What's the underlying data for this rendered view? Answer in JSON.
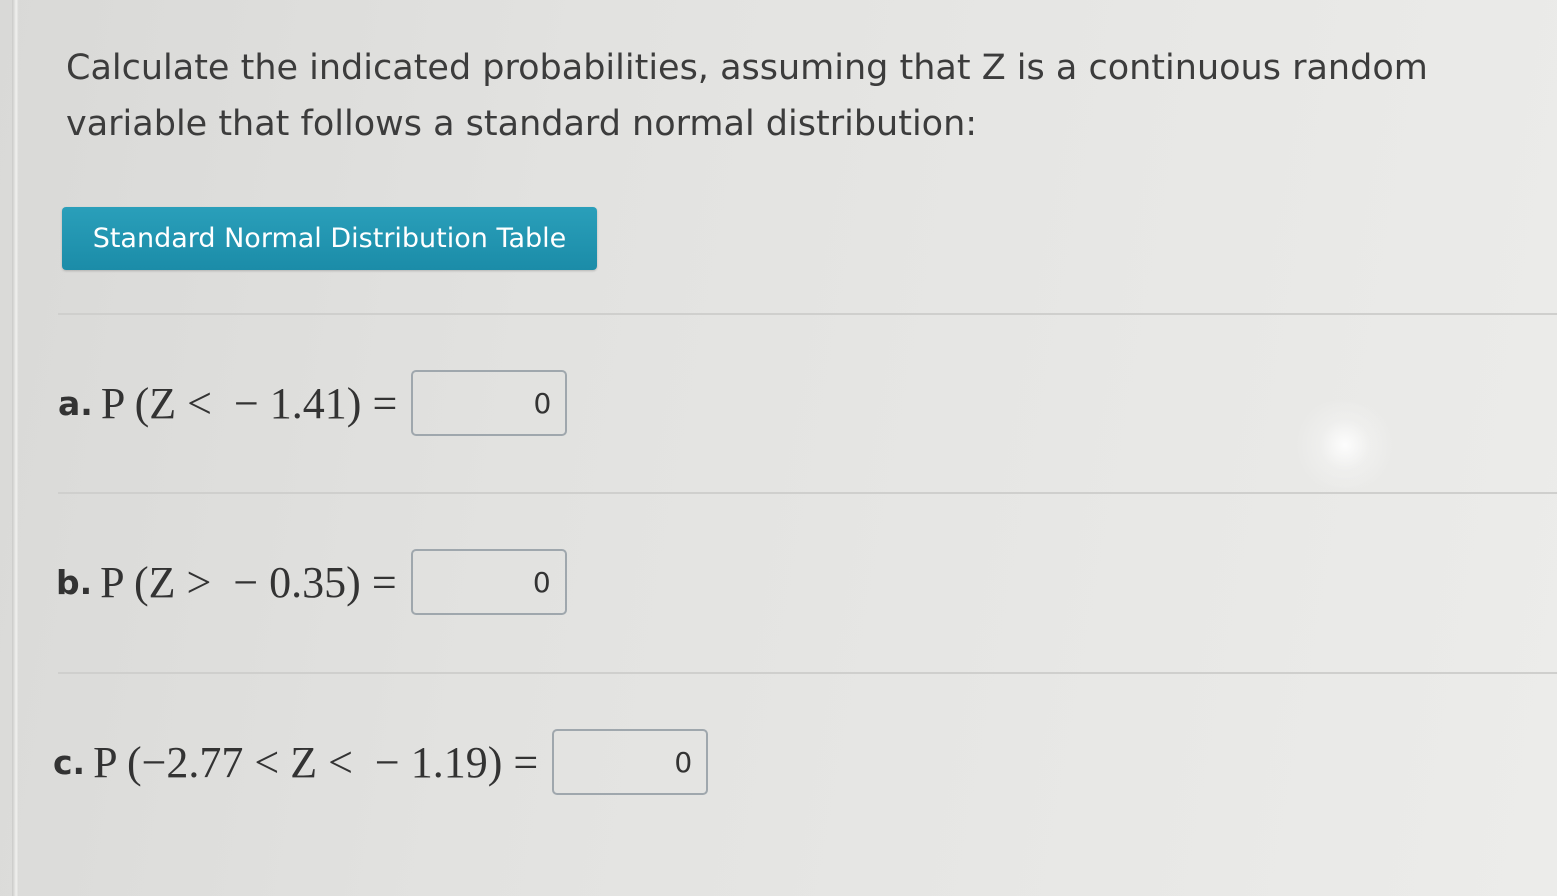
{
  "question": {
    "text": "Calculate the indicated probabilities, assuming that Z is a continuous random variable that follows a standard normal distribution:"
  },
  "table_button": {
    "label": "Standard Normal Distribution Table",
    "color": "#1f93ae"
  },
  "parts": [
    {
      "letter": "a.",
      "expression": "P (Z <  − 1.41) =",
      "answer": "0"
    },
    {
      "letter": "b.",
      "expression": "P (Z >  − 0.35) =",
      "answer": "0"
    },
    {
      "letter": "c.",
      "expression": "P (−2.77 < Z <  − 1.19) =",
      "answer": "0"
    }
  ]
}
